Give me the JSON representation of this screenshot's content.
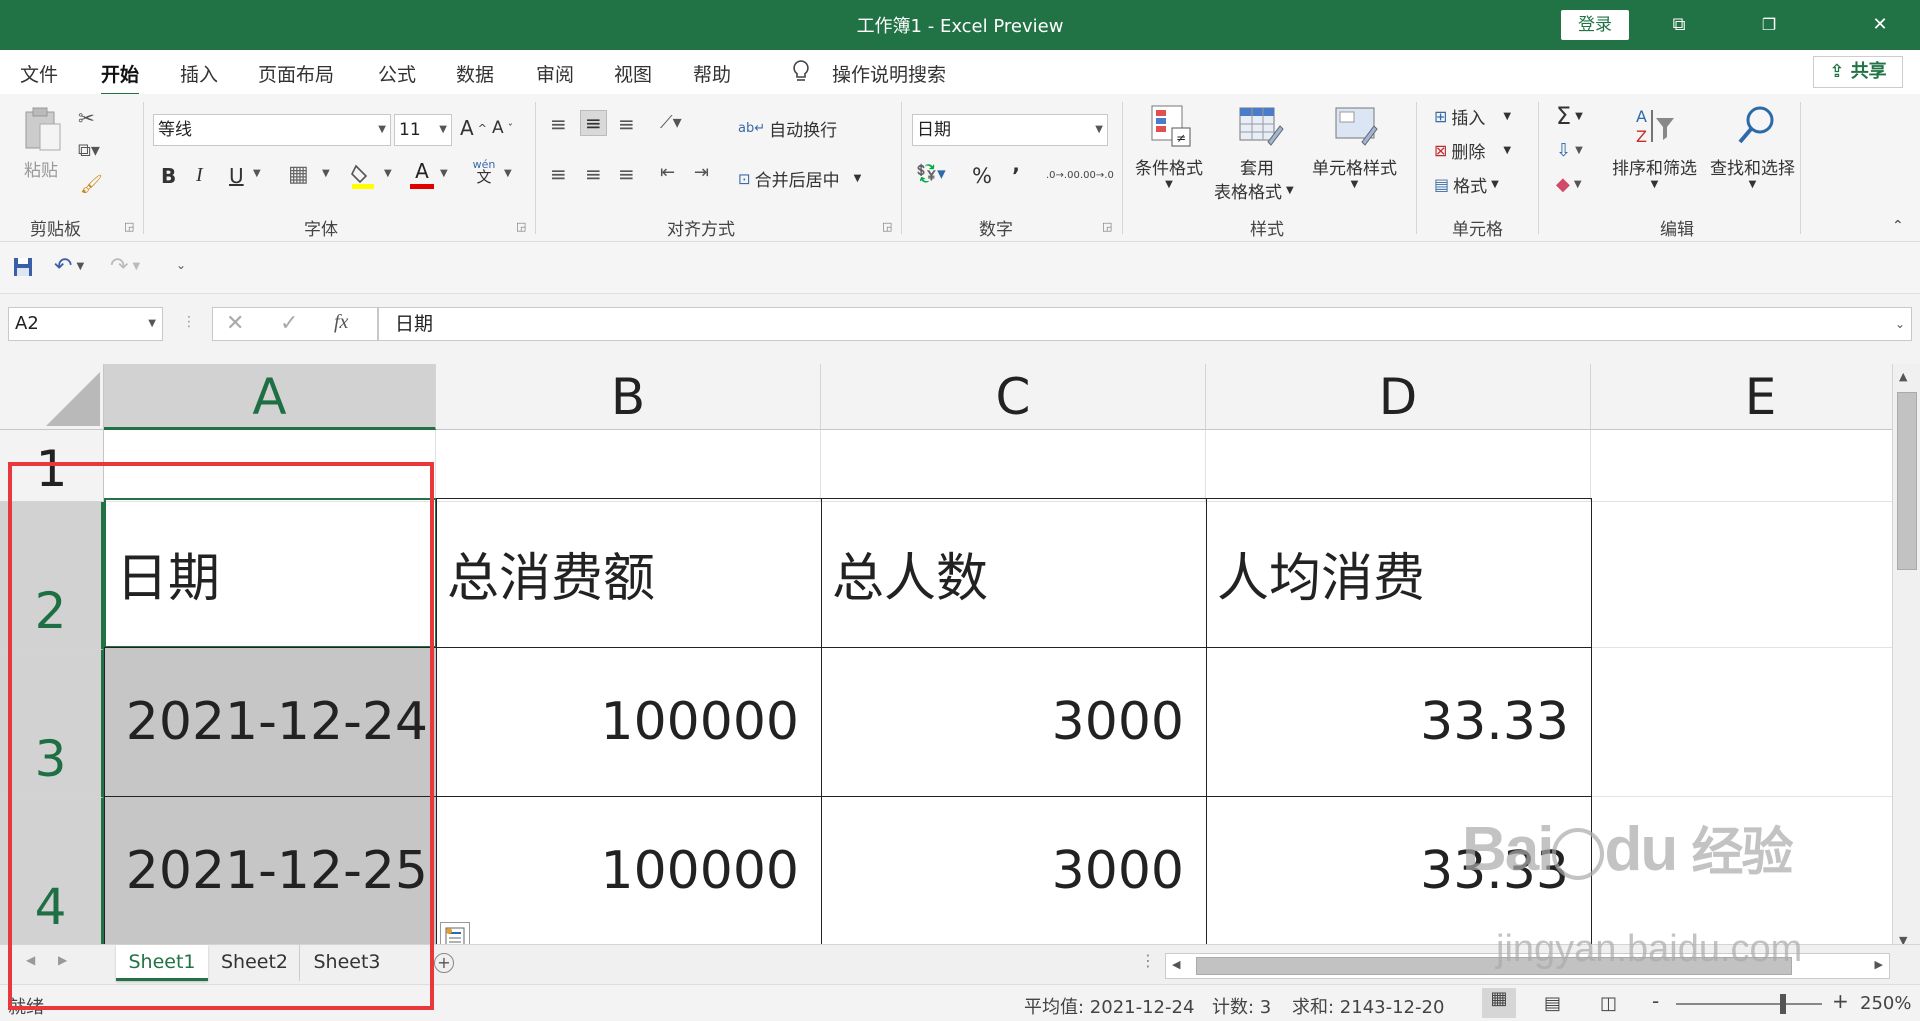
{
  "window": {
    "title": "工作簿1 - Excel Preview",
    "login_label": "登录",
    "ribbon_display_glyph": "⧉",
    "restore_glyph": "❐",
    "close_glyph": "✕"
  },
  "menu": {
    "tabs": [
      "文件",
      "开始",
      "插入",
      "页面布局",
      "公式",
      "数据",
      "审阅",
      "视图",
      "帮助"
    ],
    "active_tab": "开始",
    "search_label": "操作说明搜索",
    "share_label": "共享"
  },
  "ribbon": {
    "clipboard": {
      "label": "剪贴板",
      "paste_label": "粘贴"
    },
    "font": {
      "label": "字体",
      "font_name": "等线",
      "font_size": "11",
      "bold": "B",
      "italic": "I",
      "underline": "U",
      "grow": "A",
      "shrink": "A",
      "phonetic": "wén",
      "phonetic2": "文"
    },
    "alignment": {
      "label": "对齐方式",
      "wrap_text": "自动换行",
      "merge_center": "合并后居中"
    },
    "number": {
      "label": "数字",
      "format_value": "日期",
      "percent": "%",
      "comma": "’",
      "inc_decimal": ".0→.00",
      "dec_decimal": ".00→.0"
    },
    "styles": {
      "label": "样式",
      "conditional": "条件格式",
      "table_line1": "套用",
      "table_line2": "表格格式",
      "cell_styles": "单元格样式"
    },
    "cells": {
      "label": "单元格",
      "insert": "插入",
      "delete": "删除",
      "format": "格式"
    },
    "editing": {
      "label": "编辑",
      "sum": "Σ",
      "sort_filter": "排序和筛选",
      "find_select": "查找和选择"
    }
  },
  "formula_bar": {
    "name_box": "A2",
    "fx": "fx",
    "cancel": "✕",
    "enter": "✓",
    "content": "日期"
  },
  "sheet": {
    "columns": [
      "A",
      "B",
      "C",
      "D",
      "E"
    ],
    "selected_column": "A",
    "rows": [
      "1",
      "2",
      "3",
      "4"
    ],
    "header_row": [
      "日期",
      "总消费额",
      "总人数",
      "人均消费"
    ],
    "data_rows": [
      [
        "2021-12-24",
        "100000",
        "3000",
        "33.33"
      ],
      [
        "2021-12-25",
        "100000",
        "3000",
        "33.33"
      ]
    ]
  },
  "tabs": {
    "sheets": [
      "Sheet1",
      "Sheet2",
      "Sheet3"
    ],
    "active": "Sheet1",
    "add_glyph": "+"
  },
  "status": {
    "ready": "就绪",
    "average": "平均值: 2021-12-24",
    "count": "计数: 3",
    "sum": "求和: 2143-12-20",
    "zoom": "250%",
    "zoom_minus": "-",
    "zoom_plus": "+"
  },
  "watermark": {
    "brand": "Bai",
    "brand2": "du",
    "brand3": "经验",
    "url": "jingyan.baidu.com"
  },
  "colors": {
    "excel_green": "#217346",
    "selection_fill": "#c6c6c6",
    "highlight_red": "#e8383d"
  }
}
